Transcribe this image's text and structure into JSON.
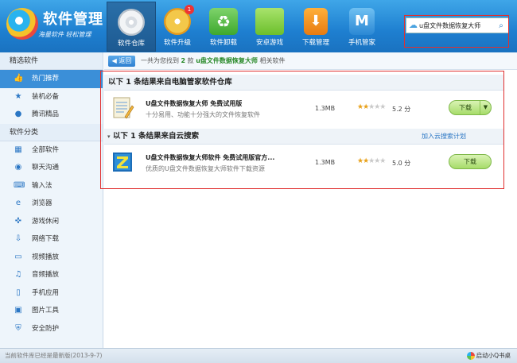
{
  "app": {
    "title": "软件管理",
    "subtitle": "海量软件 轻松管理"
  },
  "tabs": [
    {
      "label": "软件仓库",
      "icon": "cd-disc-icon",
      "active": true
    },
    {
      "label": "软件升级",
      "icon": "upgrade-icon",
      "badge": "1"
    },
    {
      "label": "软件卸载",
      "icon": "recycle-icon"
    },
    {
      "label": "安卓游戏",
      "icon": "android-icon"
    },
    {
      "label": "下载管理",
      "icon": "download-box-icon"
    },
    {
      "label": "手机管家",
      "icon": "phone-manager-icon"
    }
  ],
  "search": {
    "value": "u盘文件数据恢复大师",
    "placeholder": ""
  },
  "sidebar": {
    "featured_title": "精选软件",
    "featured": [
      {
        "label": "热门推荐",
        "icon": "thumbs-up-icon",
        "active": true
      },
      {
        "label": "装机必备",
        "icon": "star-icon"
      },
      {
        "label": "腾讯精品",
        "icon": "penguin-icon"
      }
    ],
    "category_title": "软件分类",
    "categories": [
      {
        "label": "全部软件",
        "icon": "grid-icon"
      },
      {
        "label": "聊天沟通",
        "icon": "chat-icon"
      },
      {
        "label": "输入法",
        "icon": "keyboard-icon"
      },
      {
        "label": "浏览器",
        "icon": "browser-icon"
      },
      {
        "label": "游戏休闲",
        "icon": "gamepad-icon"
      },
      {
        "label": "网络下载",
        "icon": "network-download-icon"
      },
      {
        "label": "视频播放",
        "icon": "tv-icon"
      },
      {
        "label": "音频播放",
        "icon": "music-note-icon"
      },
      {
        "label": "手机应用",
        "icon": "mobile-icon"
      },
      {
        "label": "图片工具",
        "icon": "picture-icon"
      },
      {
        "label": "安全防护",
        "icon": "shield-icon"
      }
    ]
  },
  "toolbar": {
    "back_label": "◀ 返回",
    "result_prefix": "一共为您找到",
    "result_count": "2",
    "result_mid": "款",
    "result_keyword": "u盘文件数据恢复大师",
    "result_suffix": "相关软件"
  },
  "sections": [
    {
      "title": "以下 1 条结果来自电脑管家软件仓库"
    },
    {
      "title": "以下 1 条结果来自云搜索",
      "link": "加入云搜索计划"
    }
  ],
  "results": [
    {
      "name": "U盘文件数据恢复大师 免费试用版",
      "desc": "十分易用、功能十分强大的文件恢复软件",
      "size": "1.3MB",
      "stars": 2,
      "score": "5.2 分",
      "button": "下载",
      "icon": "notepad-icon"
    },
    {
      "name": "U盘文件数据恢复大师软件 免费试用版官方...",
      "desc": "优质的U盘文件数据恢复大师软件下载资源",
      "size": "1.3MB",
      "stars": 2,
      "score": "5.0 分",
      "button": "下载",
      "icon": "z-app-icon"
    }
  ],
  "status": {
    "left": "当前软件库已经是最新版(2013-9-7)",
    "right": "启动小Q书桌"
  }
}
